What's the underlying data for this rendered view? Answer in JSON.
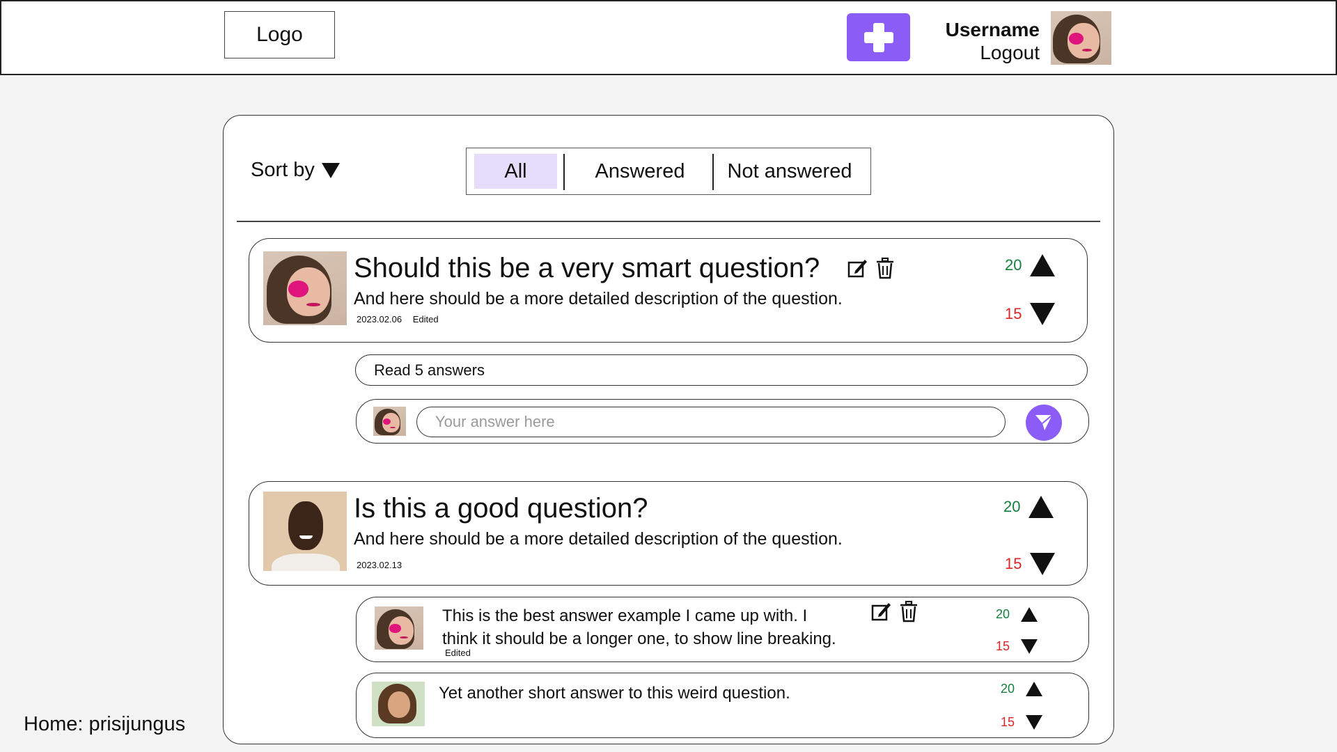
{
  "header": {
    "logo_text": "Logo",
    "username": "Username",
    "logout_label": "Logout"
  },
  "toolbar": {
    "sort_label": "Sort by",
    "filters": [
      "All",
      "Answered",
      "Not answered"
    ],
    "active_filter": "All"
  },
  "questions": [
    {
      "title": "Should this be a very smart question?",
      "description": "And here should be a more detailed description of the question.",
      "date": "2023.02.06",
      "edited_label": "Edited",
      "upvotes": "20",
      "downvotes": "15",
      "read_answers_label": "Read 5 answers",
      "answer_placeholder": "Your answer here"
    },
    {
      "title": "Is this a good question?",
      "description": "And here should be a more detailed description of the question.",
      "date": "2023.02.13",
      "upvotes": "20",
      "downvotes": "15",
      "answers": [
        {
          "line1": "This is the best answer example I came up with. I",
          "line2": "think it should be a longer one, to show line breaking.",
          "edited_label": "Edited",
          "upvotes": "20",
          "downvotes": "15"
        },
        {
          "line1": "Yet another short answer to this weird question.",
          "upvotes": "20",
          "downvotes": "15"
        }
      ]
    }
  ],
  "footer": {
    "page_label": "Home: prisijungus"
  },
  "colors": {
    "accent": "#8b5cf6",
    "active_filter_bg": "#e6ddfd",
    "upvote": "#15803d",
    "downvote": "#dc2626"
  },
  "icons": [
    "plus-icon",
    "avatar",
    "chevron-down-icon",
    "edit-icon",
    "trash-icon",
    "upvote-icon",
    "downvote-icon",
    "send-icon"
  ]
}
